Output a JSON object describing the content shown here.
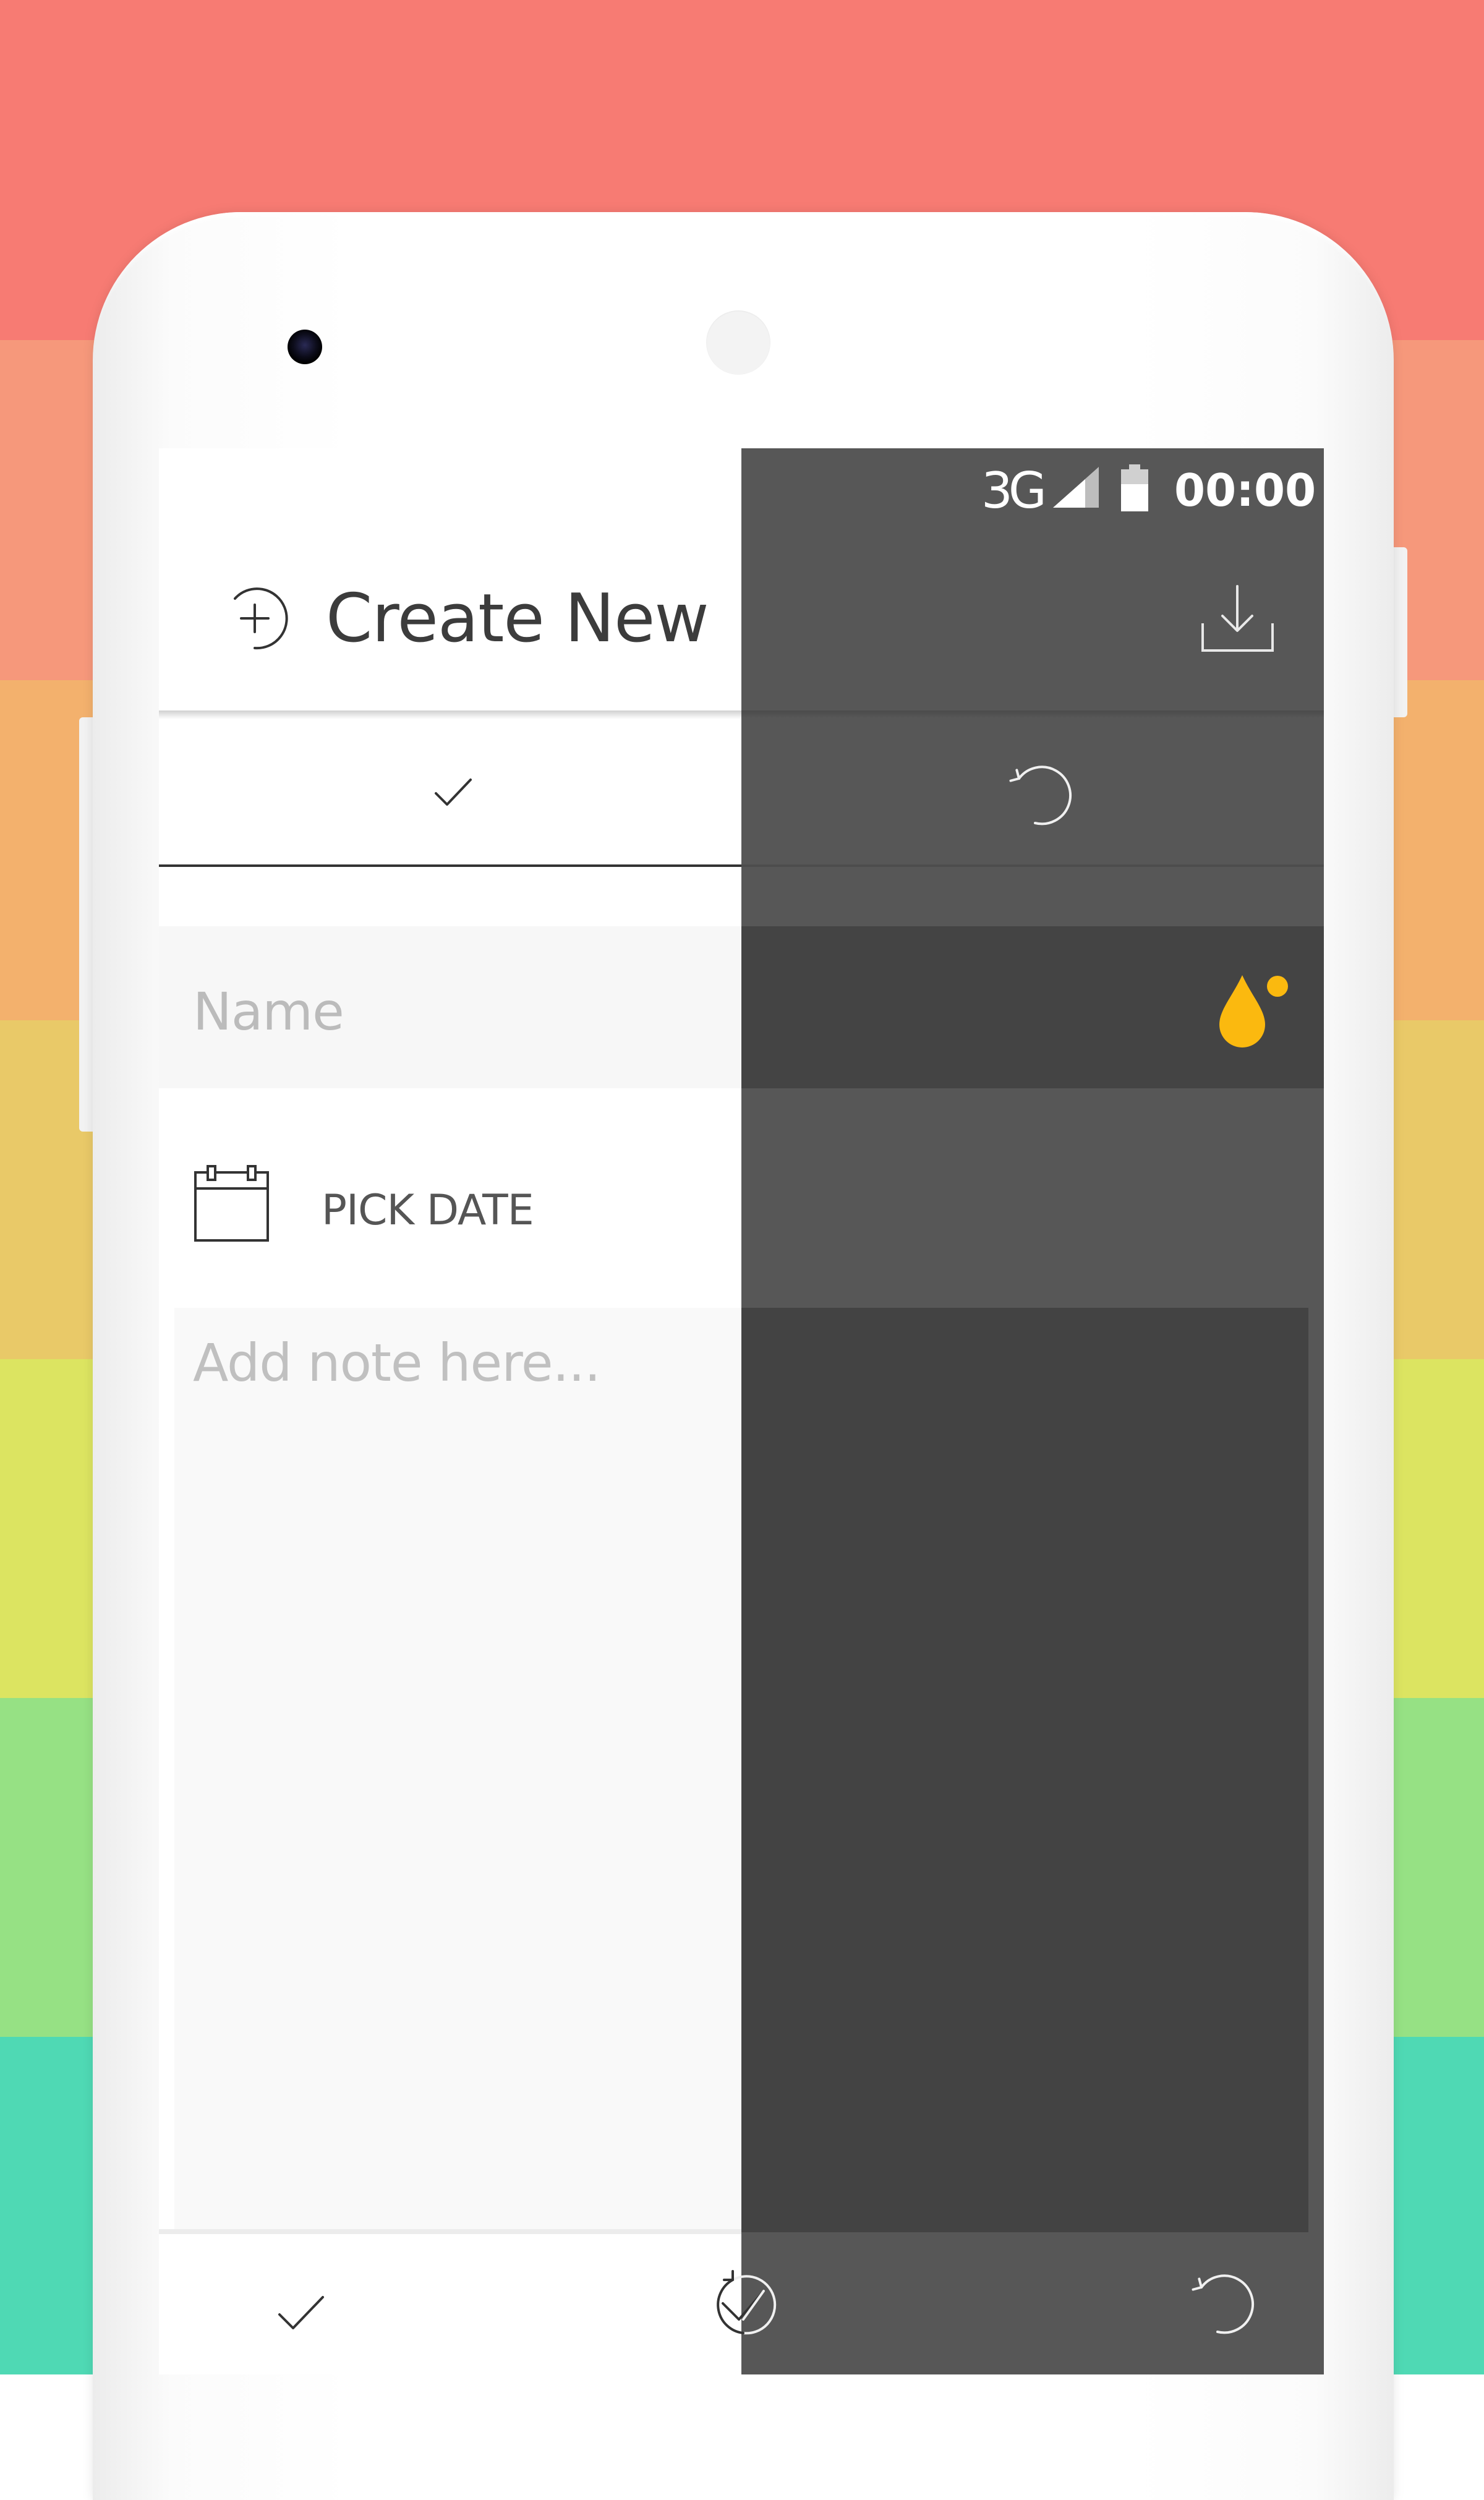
{
  "background": {
    "stripe_colors": [
      "#f77b73",
      "#f6987b",
      "#f3b16d",
      "#e9c968",
      "#dce461",
      "#96e184",
      "#4fd9b4"
    ]
  },
  "device": {
    "camera_icon": "front-camera",
    "speaker_icon": "earpiece-speaker"
  },
  "status_bar": {
    "network": "3G",
    "time": "00:00",
    "signal_icon": "cellular-signal",
    "battery_icon": "battery"
  },
  "app_bar": {
    "title": "Create New",
    "title_icon": "add-circle-icon",
    "action_icon": "download-icon"
  },
  "tabs": [
    {
      "icon": "check-icon",
      "selected": true
    },
    {
      "icon": "undo-icon",
      "selected": false
    }
  ],
  "form": {
    "name_placeholder": "Name",
    "color_picker_icon": "drop-color-icon",
    "color_picker_color": "#fbb90f",
    "date_label": "PICK DATE",
    "date_icon": "calendar-icon",
    "note_placeholder": "Add note here..."
  },
  "bottom_bar": {
    "buttons": [
      {
        "icon": "check-icon"
      },
      {
        "icon": "check-undo-icon"
      },
      {
        "icon": "undo-icon"
      }
    ]
  },
  "theme": {
    "light_bg": "#ffffff",
    "dark_bg": "#575757",
    "dark_field": "#444444",
    "accent": "#fbb90f"
  }
}
